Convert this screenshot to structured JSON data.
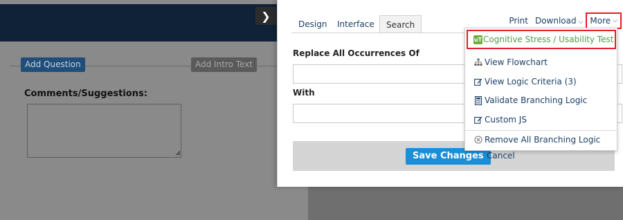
{
  "builder": {
    "add_question": "Add Question",
    "add_intro_text": "Add Intro Text",
    "comments_label": "Comments/Suggestions:",
    "collapse_icon": "chevron-right-icon"
  },
  "panel": {
    "tabs": [
      {
        "label": "Design",
        "active": false
      },
      {
        "label": "Interface",
        "active": false
      },
      {
        "label": "Search",
        "active": true
      }
    ],
    "top_links": {
      "print": "Print",
      "download": "Download",
      "more": "More"
    },
    "search": {
      "replace_label": "Replace All Occurrences Of",
      "replace_value": "",
      "with_label": "With",
      "with_value": ""
    },
    "footer": {
      "save": "Save Changes",
      "cancel": "Cancel"
    }
  },
  "more_menu": {
    "items": [
      {
        "label": "Cognitive Stress / Usability Test",
        "icon": "usability-badge-icon",
        "badge": "uT"
      },
      {
        "label": "View Flowchart",
        "icon": "sitemap-icon"
      },
      {
        "label": "View Logic Criteria (3)",
        "icon": "edit-icon"
      },
      {
        "label": "Validate Branching Logic",
        "icon": "calculator-icon"
      },
      {
        "label": "Custom JS",
        "icon": "edit-icon"
      },
      {
        "label": "Remove All Branching Logic",
        "icon": "remove-circle-icon"
      }
    ]
  },
  "colors": {
    "accent_blue": "#1a8fd8",
    "highlight_red": "#e51c24",
    "header_navy": "#0f2238",
    "link_navy": "#1b3f66"
  }
}
